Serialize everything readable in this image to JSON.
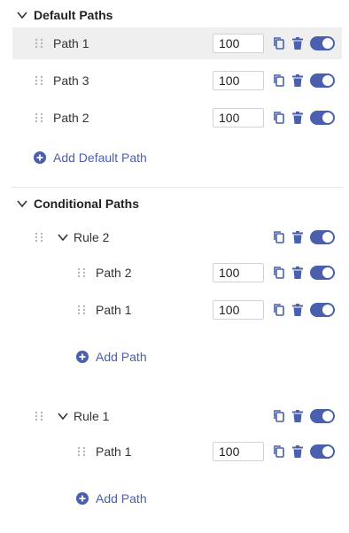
{
  "colors": {
    "accent": "#4a5fad",
    "row_highlight": "#efefef",
    "drag_handle": "#b5b5b5",
    "icon": "#4a5fad",
    "divider": "#e7e7e7"
  },
  "default_section": {
    "title": "Default Paths",
    "expanded": true,
    "paths": [
      {
        "label": "Path 1",
        "weight": "100",
        "enabled": true,
        "highlighted": true
      },
      {
        "label": "Path 3",
        "weight": "100",
        "enabled": true,
        "highlighted": false
      },
      {
        "label": "Path 2",
        "weight": "100",
        "enabled": true,
        "highlighted": false
      }
    ],
    "add_label": "Add Default Path"
  },
  "conditional_section": {
    "title": "Conditional Paths",
    "expanded": true,
    "rules": [
      {
        "label": "Rule 2",
        "enabled": true,
        "paths": [
          {
            "label": "Path 2",
            "weight": "100",
            "enabled": true
          },
          {
            "label": "Path 1",
            "weight": "100",
            "enabled": true
          }
        ],
        "add_label": "Add Path"
      },
      {
        "label": "Rule 1",
        "enabled": true,
        "paths": [
          {
            "label": "Path 1",
            "weight": "100",
            "enabled": true
          }
        ],
        "add_label": "Add Path"
      }
    ]
  },
  "icons": {
    "expand": "chevron-down-icon",
    "drag": "drag-handle-icon",
    "copy": "copy-icon",
    "delete": "trash-icon",
    "toggle": "toggle-switch",
    "add": "add-circle-icon"
  }
}
